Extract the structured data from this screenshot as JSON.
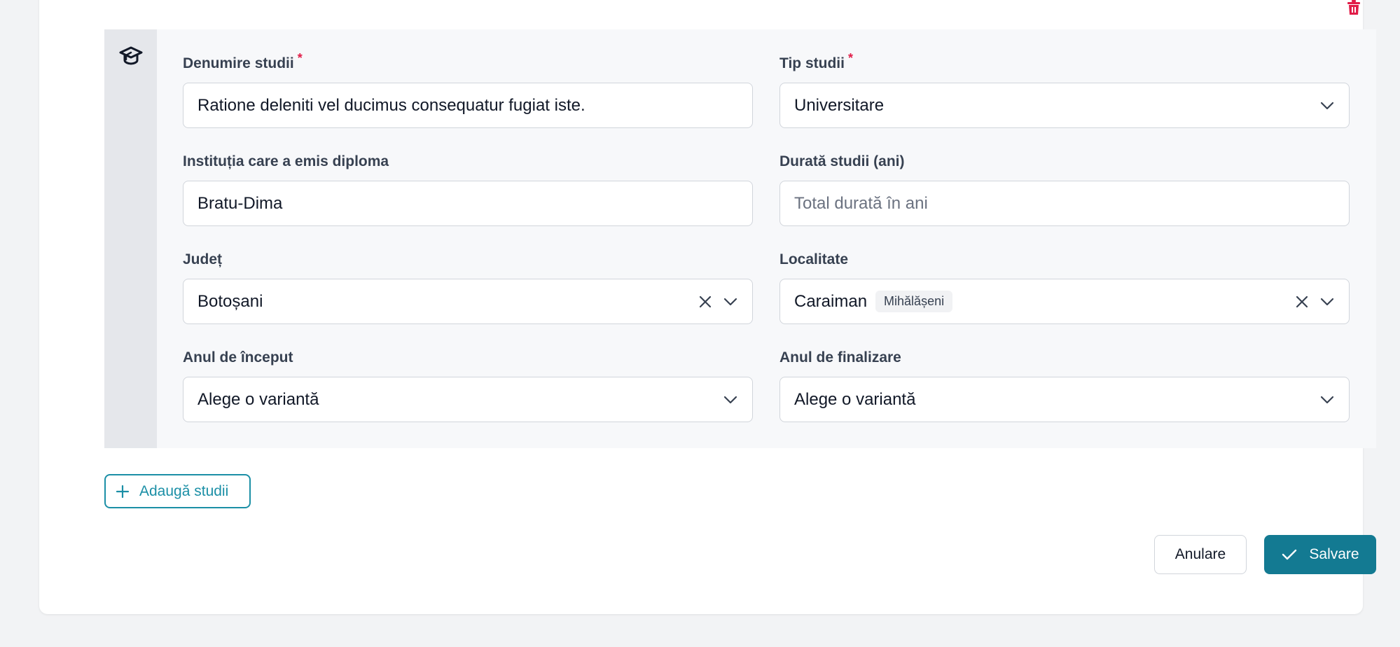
{
  "colors": {
    "accent": "#137a92",
    "outline_accent": "#1b8fa6",
    "danger": "#e11d48",
    "page_bg": "#f2f3f5"
  },
  "icons": {
    "delete": "trash-icon",
    "study": "graduation-cap-icon",
    "add": "plus-icon",
    "save": "check-icon",
    "dropdown": "chevron-down-icon",
    "clear": "close-icon"
  },
  "form": {
    "denumire": {
      "label": "Denumire studii",
      "required_mark": "*",
      "value": "Ratione deleniti vel ducimus consequatur fugiat iste."
    },
    "tip": {
      "label": "Tip studii",
      "required_mark": "*",
      "value": "Universitare"
    },
    "institutie": {
      "label": "Instituția care a emis diploma",
      "value": "Bratu-Dima"
    },
    "durata": {
      "label": "Durată studii (ani)",
      "placeholder": "Total durată în ani"
    },
    "judet": {
      "label": "Județ",
      "value": "Botoșani"
    },
    "localitate": {
      "label": "Localitate",
      "value": "Caraiman",
      "badge": "Mihălășeni"
    },
    "an_inceput": {
      "label": "Anul de început",
      "value": "Alege o variantă"
    },
    "an_finalizare": {
      "label": "Anul de finalizare",
      "value": "Alege o variantă"
    }
  },
  "actions": {
    "add_label": "Adaugă studii",
    "cancel_label": "Anulare",
    "save_label": "Salvare"
  }
}
